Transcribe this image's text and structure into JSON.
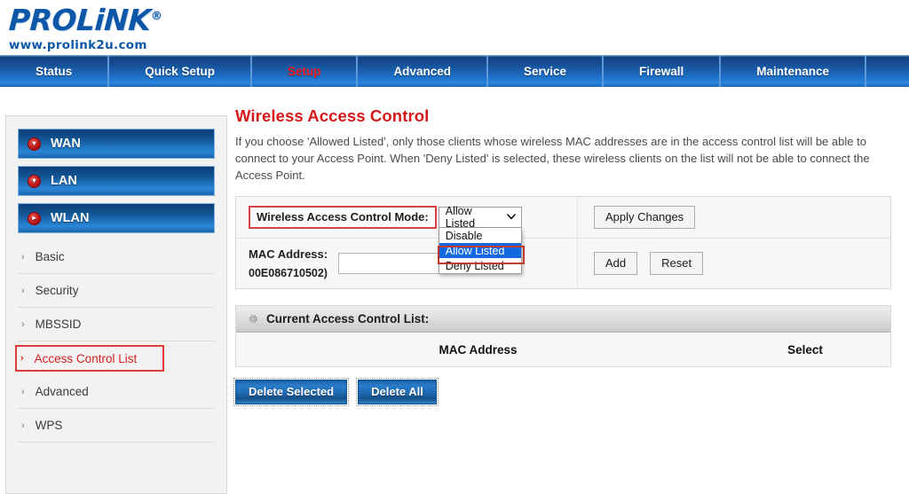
{
  "brand": {
    "name": "PROLiNK",
    "registered": "®",
    "url": "www.prolink2u.com"
  },
  "nav": {
    "items": [
      {
        "label": "Status",
        "active": false
      },
      {
        "label": "Quick Setup",
        "active": false
      },
      {
        "label": "Setup",
        "active": true
      },
      {
        "label": "Advanced",
        "active": false
      },
      {
        "label": "Service",
        "active": false
      },
      {
        "label": "Firewall",
        "active": false
      },
      {
        "label": "Maintenance",
        "active": false
      }
    ],
    "active_color": "#f21d1d"
  },
  "sidebar": {
    "groups": [
      {
        "label": "WAN",
        "icon": "chevron-down-circle-icon",
        "glyph": "▾"
      },
      {
        "label": "LAN",
        "icon": "chevron-down-circle-icon",
        "glyph": "▾"
      },
      {
        "label": "WLAN",
        "icon": "chevron-right-circle-icon",
        "glyph": "▸"
      }
    ],
    "links": [
      {
        "label": "Basic",
        "highlighted": false
      },
      {
        "label": "Security",
        "highlighted": false
      },
      {
        "label": "MBSSID",
        "highlighted": false
      },
      {
        "label": "Access Control List",
        "highlighted": true
      },
      {
        "label": "Advanced",
        "highlighted": false
      },
      {
        "label": "WPS",
        "highlighted": false
      }
    ],
    "chevron": "›",
    "highlight_color": "#d52020"
  },
  "main": {
    "title": "Wireless Access Control",
    "intro": "If you choose 'Allowed Listed', only those clients whose wireless MAC addresses are in the access control list will be able to connect to your Access Point. When 'Deny Listed' is selected, these wireless clients on the list will not be able to connect the Access Point.",
    "title_color": "#d6181a"
  },
  "form": {
    "mode_label": "Wireless Access Control Mode:",
    "mode_value": "Allow Listed",
    "mode_caret": "⌄",
    "mode_options": [
      {
        "label": "Disable",
        "selected": false
      },
      {
        "label": "Allow Listed",
        "selected": true
      },
      {
        "label": "Deny Listed",
        "selected": false
      }
    ],
    "apply_label": "Apply Changes",
    "mac_label": "MAC Address:",
    "mac_hint": "00E086710502)",
    "mac_value": "",
    "mac_placeholder": "",
    "add_label": "Add",
    "reset_label": "Reset",
    "selection_color": "#1569e0",
    "annotation_color": "#c0392b"
  },
  "acl": {
    "header": "Current Access Control List:",
    "header_icon": "gear-icon",
    "columns": [
      "MAC Address",
      "Select"
    ],
    "rows": []
  },
  "footer": {
    "delete_selected_label": "Delete Selected",
    "delete_all_label": "Delete All"
  }
}
